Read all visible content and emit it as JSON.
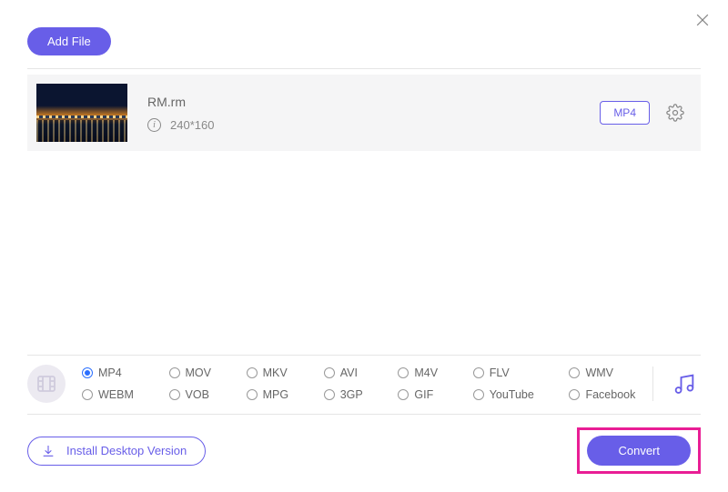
{
  "header": {
    "add_file_label": "Add File"
  },
  "file": {
    "name": "RM.rm",
    "resolution": "240*160",
    "target_format": "MP4"
  },
  "formats": [
    {
      "label": "MP4",
      "selected": true
    },
    {
      "label": "MOV",
      "selected": false
    },
    {
      "label": "MKV",
      "selected": false
    },
    {
      "label": "AVI",
      "selected": false
    },
    {
      "label": "M4V",
      "selected": false
    },
    {
      "label": "FLV",
      "selected": false
    },
    {
      "label": "WMV",
      "selected": false
    },
    {
      "label": "WEBM",
      "selected": false
    },
    {
      "label": "VOB",
      "selected": false
    },
    {
      "label": "MPG",
      "selected": false
    },
    {
      "label": "3GP",
      "selected": false
    },
    {
      "label": "GIF",
      "selected": false
    },
    {
      "label": "YouTube",
      "selected": false
    },
    {
      "label": "Facebook",
      "selected": false
    }
  ],
  "actions": {
    "install_label": "Install Desktop Version",
    "convert_label": "Convert"
  },
  "colors": {
    "accent": "#685ee8",
    "highlight": "#e91e95"
  }
}
